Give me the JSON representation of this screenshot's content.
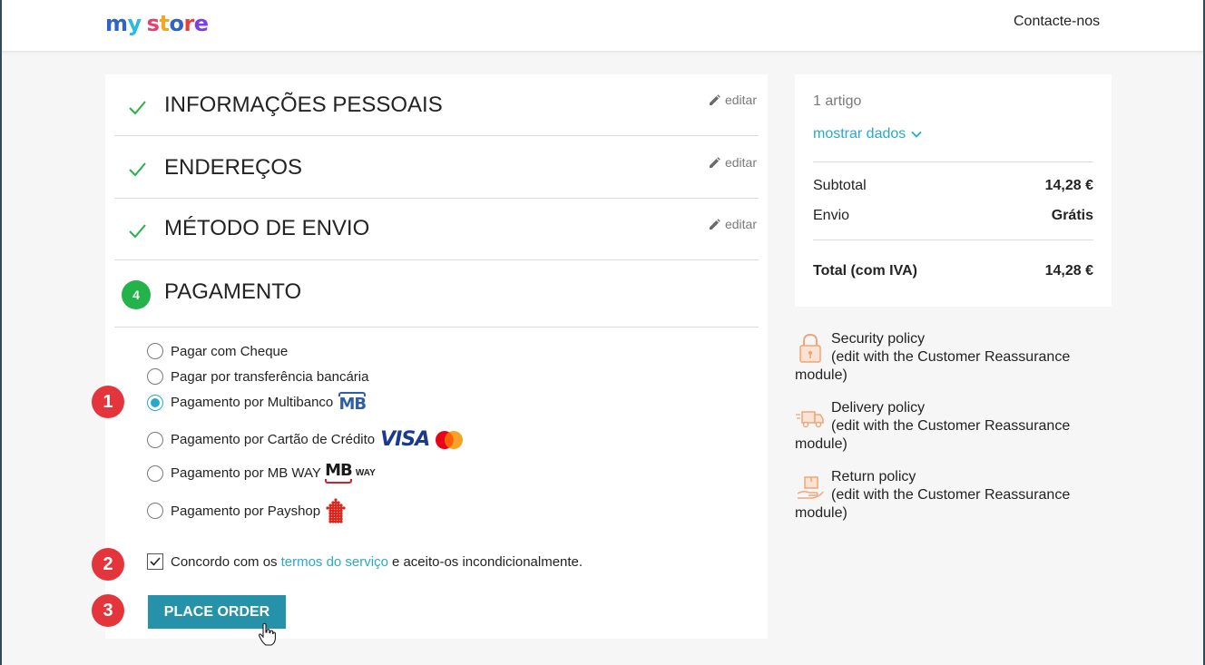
{
  "header": {
    "logo": {
      "m": "m",
      "y": "y",
      "space": " ",
      "s": "s",
      "t": "t",
      "o": "o",
      "r": "r",
      "e": "e"
    },
    "contact_label": "Contacte-nos"
  },
  "steps": [
    {
      "title": "INFORMAÇÕES PESSOAIS",
      "edit_label": "editar",
      "status": "complete"
    },
    {
      "title": "ENDEREÇOS",
      "edit_label": "editar",
      "status": "complete"
    },
    {
      "title": "MÉTODO DE ENVIO",
      "edit_label": "editar",
      "status": "complete"
    },
    {
      "number": "4",
      "title": "PAGAMENTO",
      "status": "current"
    }
  ],
  "payment_options": [
    {
      "label": "Pagar com Cheque",
      "selected": false
    },
    {
      "label": "Pagar por transferência bancária",
      "selected": false
    },
    {
      "label": "Pagamento por Multibanco",
      "selected": true,
      "logo": "MB"
    },
    {
      "label": "Pagamento por Cartão de Crédito",
      "selected": false,
      "logo": "VISA"
    },
    {
      "label": "Pagamento por MB WAY",
      "selected": false,
      "logo": "MB",
      "logo_suffix": "WAY"
    },
    {
      "label": "Pagamento por Payshop",
      "selected": false,
      "logo": "payshop-icon"
    }
  ],
  "terms": {
    "before": "Concordo com os",
    "link": "termos do serviço",
    "after": "e aceito-os incondicionalmente.",
    "checked": true
  },
  "place_order_label": "PLACE ORDER",
  "callouts": [
    "1",
    "2",
    "3"
  ],
  "summary": {
    "items_count": "1 artigo",
    "show_details": "mostrar dados",
    "subtotal_label": "Subtotal",
    "subtotal_value": "14,28 €",
    "shipping_label": "Envio",
    "shipping_value": "Grátis",
    "total_label": "Total (com IVA)",
    "total_value": "14,28 €"
  },
  "policies": [
    {
      "title": "Security policy",
      "desc_1": "(edit with the Customer Reassurance",
      "desc_2": "module)",
      "icon": "lock-icon"
    },
    {
      "title": "Delivery policy",
      "desc_1": "(edit with the Customer Reassurance",
      "desc_2": "module)",
      "icon": "truck-icon"
    },
    {
      "title": "Return policy",
      "desc_1": "(edit with the Customer Reassurance",
      "desc_2": "module)",
      "icon": "return-box-icon"
    }
  ],
  "colors": {
    "accent": "#2aa8c9",
    "button": "#2592a9",
    "success": "#24b24b",
    "callout": "#e3353b"
  }
}
